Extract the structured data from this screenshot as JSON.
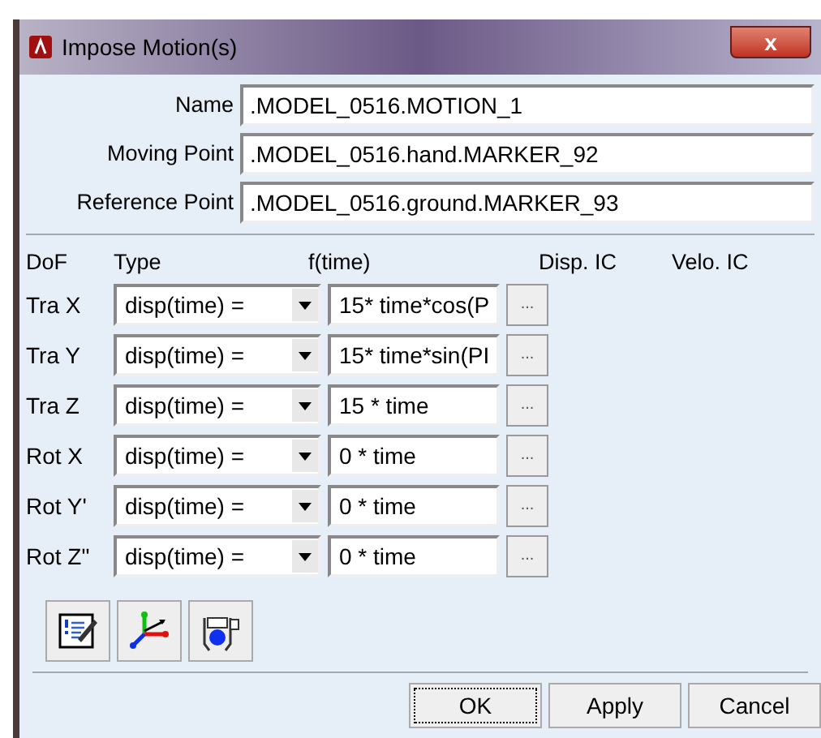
{
  "window": {
    "title": "Impose Motion(s)",
    "close": "x"
  },
  "fields": [
    {
      "label": "Name",
      "value": ".MODEL_0516.MOTION_1"
    },
    {
      "label": "Moving Point",
      "value": ".MODEL_0516.hand.MARKER_92"
    },
    {
      "label": "Reference Point",
      "value": ".MODEL_0516.ground.MARKER_93"
    }
  ],
  "table": {
    "columns": [
      "DoF",
      "Type",
      "f(time)",
      "Disp. IC",
      "Velo. IC"
    ],
    "rows": [
      {
        "dof": "Tra X",
        "type": "disp(time) =",
        "f": "15* time*cos(P",
        "more": "..."
      },
      {
        "dof": "Tra Y",
        "type": "disp(time) =",
        "f": "15* time*sin(PI",
        "more": "..."
      },
      {
        "dof": "Tra Z",
        "type": "disp(time) =",
        "f": "15 * time",
        "more": "..."
      },
      {
        "dof": "Rot X",
        "type": "disp(time) =",
        "f": "0 * time",
        "more": "..."
      },
      {
        "dof": "Rot Y'",
        "type": "disp(time) =",
        "f": "0 * time",
        "more": "..."
      },
      {
        "dof": "Rot Z\"",
        "type": "disp(time) =",
        "f": "0 * time",
        "more": "..."
      }
    ]
  },
  "tools": [
    {
      "kind": "notes"
    },
    {
      "kind": "axes"
    },
    {
      "kind": "caliper"
    }
  ],
  "buttons": [
    {
      "label": "OK",
      "focused": true
    },
    {
      "label": "Apply",
      "focused": false
    },
    {
      "label": "Cancel",
      "focused": false
    }
  ]
}
